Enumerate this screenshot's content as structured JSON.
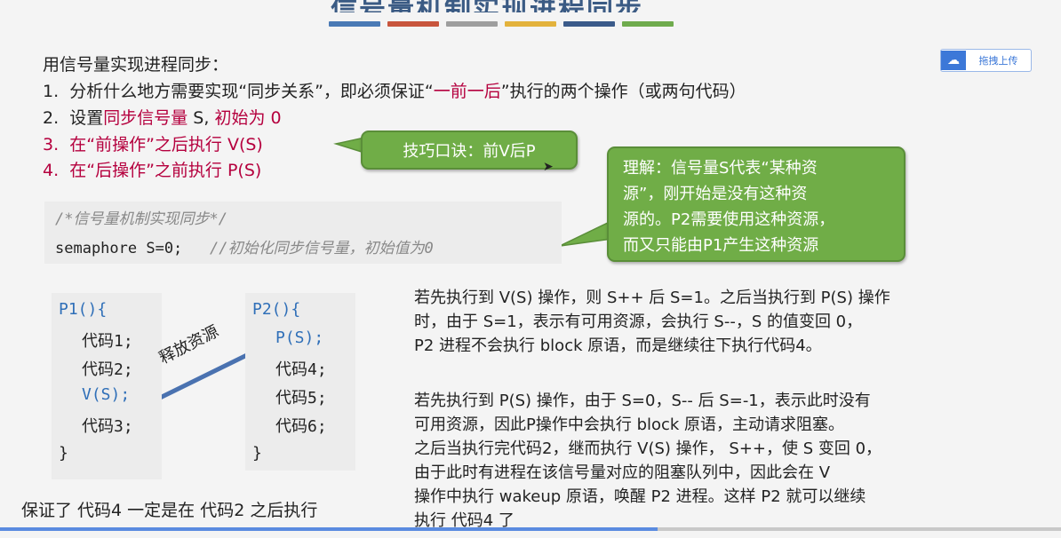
{
  "header": {
    "title": "信号量机制实现进程同步",
    "bar_colors": [
      "#4a7ab5",
      "#c8553d",
      "#9e9e9e",
      "#e3b23c",
      "#3b5b8a",
      "#6fab4d"
    ]
  },
  "upload_button": {
    "label": "拖拽上传",
    "icon": "cloud-icon"
  },
  "intro": "用信号量实现进程同步：",
  "steps": [
    {
      "num": "1.",
      "parts": [
        "分析什么地方需要实现“同步关系”，即必须保证“",
        "一前一后",
        "”执行的两个操作（或两句代码）"
      ]
    },
    {
      "num": "2.",
      "parts": [
        "设置",
        "同步信号量",
        " S, ",
        "初始为 0"
      ]
    },
    {
      "num": "3.",
      "text": "在“前操作”之后执行 V(S)"
    },
    {
      "num": "4.",
      "text": "在“后操作”之前执行 P(S)"
    }
  ],
  "tip_callout": "技巧口诀：前V后P",
  "explain_callout": [
    "理解：信号量S代表“某种资",
    "源”，刚开始是没有这种资",
    "源的。P2需要使用这种资源，",
    "而又只能由P1产生这种资源"
  ],
  "code": {
    "comment": "/*信号量机制实现同步*/",
    "decl": "semaphore S=0;",
    "decl_comment": "//初始化同步信号量，初始值为0"
  },
  "p1": [
    "P1(){",
    "代码1;",
    "代码2;",
    "V(S);",
    "代码3;",
    "}"
  ],
  "p2": [
    "P2(){",
    "P(S);",
    "代码4;",
    "代码5;",
    "代码6;",
    "}"
  ],
  "arrow_label": "释放资源",
  "para1": [
    "若先执行到 V(S) 操作，则 S++ 后 S=1。之后当执行到 P(S) 操作",
    "时，由于 S=1，表示有可用资源，会执行 S--，S 的值变回 0，",
    "P2 进程不会执行 block 原语，而是继续往下执行代码4。"
  ],
  "para2": [
    "若先执行到 P(S) 操作，由于 S=0，S-- 后 S=-1，表示此时没有",
    "可用资源，因此P操作中会执行 block 原语，主动请求阻塞。",
    "之后当执行完代码2，继而执行 V(S) 操作， S++，使 S 变回 0，",
    "由于此时有进程在该信号量对应的阻塞队列中，因此会在 V",
    "操作中执行 wakeup 原语，唤醒 P2 进程。这样 P2 就可以继续",
    "执行 代码4 了"
  ],
  "bottom_note": "保证了 代码4 一定是在 代码2 之后执行",
  "video_progress": 0.62
}
